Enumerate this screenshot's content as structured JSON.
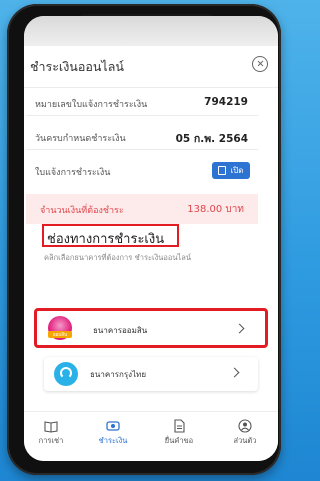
{
  "header": {
    "title": "ชำระเงินออนไลน์",
    "close_icon": "close-circle-icon"
  },
  "invoice": {
    "rows": [
      {
        "label": "หมายเลขใบแจ้งการชำระเงิน",
        "value": "794219"
      },
      {
        "label": "วันครบกำหนดชำระเงิน",
        "value": "05 ก.พ. 2564"
      },
      {
        "label": "ใบแจ้งการชำระเงิน",
        "button": "เปิด"
      }
    ],
    "amount_label": "จำนวนเงินที่ต้องชำระ",
    "amount_value": "138.00 บาท"
  },
  "payment": {
    "title": "ช่องทางการชำระเงิน",
    "subtitle": "คลิกเลือกธนาคารที่ต้องการ ชำระเงินออนไลน์",
    "banks": [
      {
        "name": "ธนาคารออมสิน",
        "logo_label": "ออมสิน",
        "selected": true
      },
      {
        "name": "ธนาคารกรุงไทย",
        "selected": false
      }
    ]
  },
  "tabs": [
    {
      "label": "การเช่า",
      "icon": "book-icon",
      "active": false
    },
    {
      "label": "ชำระเงิน",
      "icon": "payment-icon",
      "active": true
    },
    {
      "label": "ยื่นคำขอ",
      "icon": "document-icon",
      "active": false
    },
    {
      "label": "ส่วนตัว",
      "icon": "profile-icon",
      "active": false
    }
  ],
  "colors": {
    "accent": "#2c73d2",
    "highlight": "#e31b23",
    "amount": "#e0474c",
    "background": "#2f9be0"
  }
}
